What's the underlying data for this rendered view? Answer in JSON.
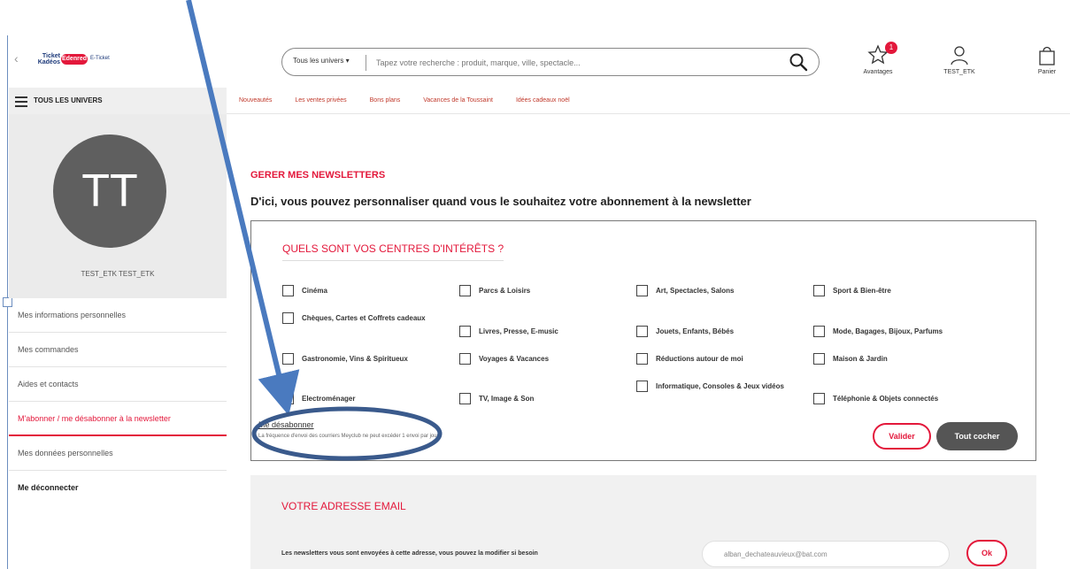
{
  "header": {
    "back_glyph": "‹",
    "logo": {
      "ticket_text": "Ticket Kadéos",
      "badge_text": "Edenred",
      "eticket_text": "E-Ticket"
    },
    "search": {
      "scope_label": "Tous les univers ▾",
      "placeholder": "Tapez votre recherche : produit, marque, ville, spectacle..."
    },
    "icons": [
      {
        "name": "star-icon",
        "label": "Avantages",
        "badge": "1"
      },
      {
        "name": "user-icon",
        "label": "TEST_ETK"
      },
      {
        "name": "bag-icon",
        "label": "Panier"
      }
    ]
  },
  "nav": {
    "univers_label": "TOUS LES UNIVERS",
    "links": [
      "Nouveautés",
      "Les ventes privées",
      "Bons plans",
      "Vacances de la Toussaint",
      "Idées cadeaux noël"
    ]
  },
  "sidebar": {
    "avatar_initials": "TT",
    "user_name": "TEST_ETK TEST_ETK",
    "menu": [
      {
        "label": "Mes informations personnelles"
      },
      {
        "label": "Mes commandes"
      },
      {
        "label": "Aides et contacts"
      },
      {
        "label": "M'abonner / me désabonner à la newsletter"
      },
      {
        "label": "Mes données personnelles"
      },
      {
        "label": "Me déconnecter"
      }
    ]
  },
  "main": {
    "heading": "GERER MES NEWSLETTERS",
    "subheading": "D'ici, vous pouvez personnaliser quand vous le souhaitez votre abonnement à la newsletter",
    "interests": {
      "title": "QUELS SONT VOS CENTRES D'INTÉRÊTS ?",
      "options": [
        "Cinéma",
        "Parcs & Loisirs",
        "Art, Spectacles, Salons",
        "Sport & Bien-être",
        "Chèques, Cartes et Coffrets cadeaux",
        "Livres, Presse, E-music",
        "Jouets, Enfants, Bébés",
        "Mode, Bagages, Bijoux, Parfums",
        "Gastronomie, Vins & Spiritueux",
        "Voyages & Vacances",
        "Réductions autour de moi",
        "Maison & Jardin",
        "Electroménager",
        "TV, Image & Son",
        "Informatique, Consoles & Jeux vidéos",
        "Téléphonie & Objets connectés"
      ],
      "unsubscribe_label": "Me désabonner",
      "frequency_note": "La fréquence d'envoi des courriers Meyclub ne peut excéder 1 envoi par jour.",
      "validate_label": "Valider",
      "check_all_label": "Tout cocher"
    },
    "email": {
      "title": "VOTRE ADRESSE EMAIL",
      "description": "Les newsletters vous sont envoyées à cette adresse, vous pouvez la modifier si besoin",
      "value": "alban_dechateauvieux@bat.com",
      "ok_label": "Ok"
    }
  },
  "annotation": {
    "color": "#4a7abf"
  },
  "colors": {
    "accent": "#e3183b",
    "dark_button": "#555555"
  }
}
